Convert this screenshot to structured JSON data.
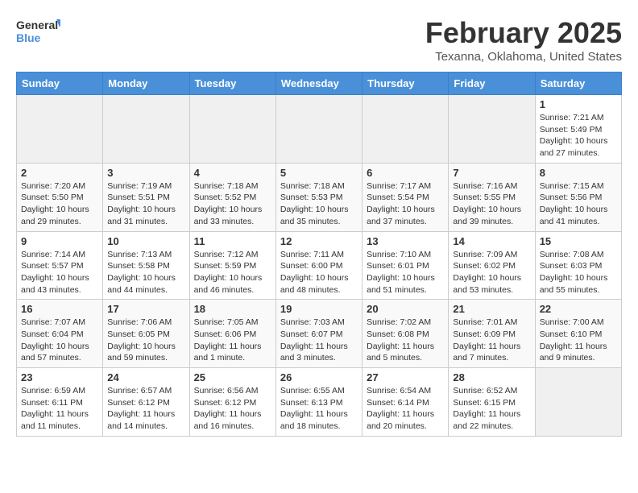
{
  "logo": {
    "line1": "General",
    "line2": "Blue"
  },
  "title": "February 2025",
  "location": "Texanna, Oklahoma, United States",
  "days_of_week": [
    "Sunday",
    "Monday",
    "Tuesday",
    "Wednesday",
    "Thursday",
    "Friday",
    "Saturday"
  ],
  "weeks": [
    [
      {
        "day": "",
        "info": ""
      },
      {
        "day": "",
        "info": ""
      },
      {
        "day": "",
        "info": ""
      },
      {
        "day": "",
        "info": ""
      },
      {
        "day": "",
        "info": ""
      },
      {
        "day": "",
        "info": ""
      },
      {
        "day": "1",
        "info": "Sunrise: 7:21 AM\nSunset: 5:49 PM\nDaylight: 10 hours\nand 27 minutes."
      }
    ],
    [
      {
        "day": "2",
        "info": "Sunrise: 7:20 AM\nSunset: 5:50 PM\nDaylight: 10 hours\nand 29 minutes."
      },
      {
        "day": "3",
        "info": "Sunrise: 7:19 AM\nSunset: 5:51 PM\nDaylight: 10 hours\nand 31 minutes."
      },
      {
        "day": "4",
        "info": "Sunrise: 7:18 AM\nSunset: 5:52 PM\nDaylight: 10 hours\nand 33 minutes."
      },
      {
        "day": "5",
        "info": "Sunrise: 7:18 AM\nSunset: 5:53 PM\nDaylight: 10 hours\nand 35 minutes."
      },
      {
        "day": "6",
        "info": "Sunrise: 7:17 AM\nSunset: 5:54 PM\nDaylight: 10 hours\nand 37 minutes."
      },
      {
        "day": "7",
        "info": "Sunrise: 7:16 AM\nSunset: 5:55 PM\nDaylight: 10 hours\nand 39 minutes."
      },
      {
        "day": "8",
        "info": "Sunrise: 7:15 AM\nSunset: 5:56 PM\nDaylight: 10 hours\nand 41 minutes."
      }
    ],
    [
      {
        "day": "9",
        "info": "Sunrise: 7:14 AM\nSunset: 5:57 PM\nDaylight: 10 hours\nand 43 minutes."
      },
      {
        "day": "10",
        "info": "Sunrise: 7:13 AM\nSunset: 5:58 PM\nDaylight: 10 hours\nand 44 minutes."
      },
      {
        "day": "11",
        "info": "Sunrise: 7:12 AM\nSunset: 5:59 PM\nDaylight: 10 hours\nand 46 minutes."
      },
      {
        "day": "12",
        "info": "Sunrise: 7:11 AM\nSunset: 6:00 PM\nDaylight: 10 hours\nand 48 minutes."
      },
      {
        "day": "13",
        "info": "Sunrise: 7:10 AM\nSunset: 6:01 PM\nDaylight: 10 hours\nand 51 minutes."
      },
      {
        "day": "14",
        "info": "Sunrise: 7:09 AM\nSunset: 6:02 PM\nDaylight: 10 hours\nand 53 minutes."
      },
      {
        "day": "15",
        "info": "Sunrise: 7:08 AM\nSunset: 6:03 PM\nDaylight: 10 hours\nand 55 minutes."
      }
    ],
    [
      {
        "day": "16",
        "info": "Sunrise: 7:07 AM\nSunset: 6:04 PM\nDaylight: 10 hours\nand 57 minutes."
      },
      {
        "day": "17",
        "info": "Sunrise: 7:06 AM\nSunset: 6:05 PM\nDaylight: 10 hours\nand 59 minutes."
      },
      {
        "day": "18",
        "info": "Sunrise: 7:05 AM\nSunset: 6:06 PM\nDaylight: 11 hours\nand 1 minute."
      },
      {
        "day": "19",
        "info": "Sunrise: 7:03 AM\nSunset: 6:07 PM\nDaylight: 11 hours\nand 3 minutes."
      },
      {
        "day": "20",
        "info": "Sunrise: 7:02 AM\nSunset: 6:08 PM\nDaylight: 11 hours\nand 5 minutes."
      },
      {
        "day": "21",
        "info": "Sunrise: 7:01 AM\nSunset: 6:09 PM\nDaylight: 11 hours\nand 7 minutes."
      },
      {
        "day": "22",
        "info": "Sunrise: 7:00 AM\nSunset: 6:10 PM\nDaylight: 11 hours\nand 9 minutes."
      }
    ],
    [
      {
        "day": "23",
        "info": "Sunrise: 6:59 AM\nSunset: 6:11 PM\nDaylight: 11 hours\nand 11 minutes."
      },
      {
        "day": "24",
        "info": "Sunrise: 6:57 AM\nSunset: 6:12 PM\nDaylight: 11 hours\nand 14 minutes."
      },
      {
        "day": "25",
        "info": "Sunrise: 6:56 AM\nSunset: 6:12 PM\nDaylight: 11 hours\nand 16 minutes."
      },
      {
        "day": "26",
        "info": "Sunrise: 6:55 AM\nSunset: 6:13 PM\nDaylight: 11 hours\nand 18 minutes."
      },
      {
        "day": "27",
        "info": "Sunrise: 6:54 AM\nSunset: 6:14 PM\nDaylight: 11 hours\nand 20 minutes."
      },
      {
        "day": "28",
        "info": "Sunrise: 6:52 AM\nSunset: 6:15 PM\nDaylight: 11 hours\nand 22 minutes."
      },
      {
        "day": "",
        "info": ""
      }
    ]
  ]
}
